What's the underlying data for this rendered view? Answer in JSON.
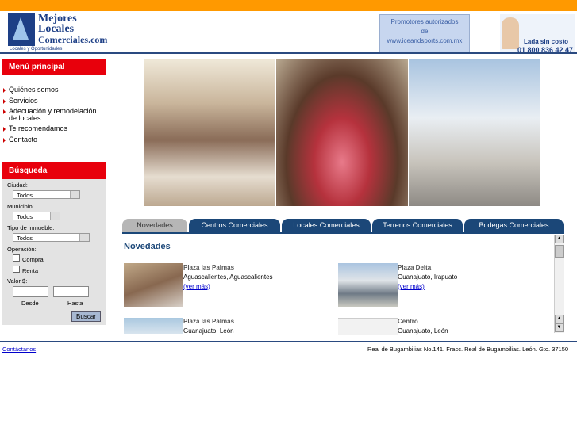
{
  "header": {
    "logo": {
      "line1": "Mejores",
      "line2": "Locales",
      "line3": "Comerciales.com",
      "tagline": "Locales y Oportunidades"
    },
    "promo": {
      "line1": "Promotores autorizados",
      "line2": "de",
      "line3": "www.iceandsports.com.mx"
    },
    "lada": {
      "line1": "Lada sin costo",
      "line2": "01 800 836 42 47"
    }
  },
  "menu": {
    "title": "Menú  principal",
    "items": [
      "Quiénes somos",
      "Servicios",
      "Adecuación y remodelación",
      "de locales",
      "Te recomendamos",
      "Contacto"
    ]
  },
  "busqueda": {
    "title": "Búsqueda",
    "ciudad_label": "Ciudad:",
    "ciudad_value": "Todos",
    "municipio_label": "Municipio:",
    "municipio_value": "Todos",
    "tipo_label": "Tipo de inmueble:",
    "tipo_value": "Todos",
    "operacion_label": "Operación:",
    "compra_label": "Compra",
    "renta_label": "Renta",
    "valor_label": "Valor $:",
    "desde_label": "Desde",
    "hasta_label": "Hasta",
    "buscar_label": "Buscar"
  },
  "tabs": [
    "Novedades",
    "Centros Comerciales",
    "Locales Comerciales",
    "Terrenos Comerciales",
    "Bodegas Comerciales"
  ],
  "novedades": {
    "title": "Novedades",
    "items": [
      {
        "title": "Plaza las Palmas",
        "location": "Aguascalientes, Aguascalientes",
        "link": "(ver más)"
      },
      {
        "title": "Plaza Delta",
        "location": "Guanajuato, Irapuato",
        "link": "(ver más)"
      },
      {
        "title": "Plaza las Palmas",
        "location": "Guanajuato, León"
      },
      {
        "title": "Centro",
        "location": "Guanajuato, León"
      }
    ]
  },
  "footer": {
    "contact": "Contáctanos",
    "address": "Real de Bugambilias No.141. Fracc. Real de Bugambilias. León. Gto. 37150"
  }
}
